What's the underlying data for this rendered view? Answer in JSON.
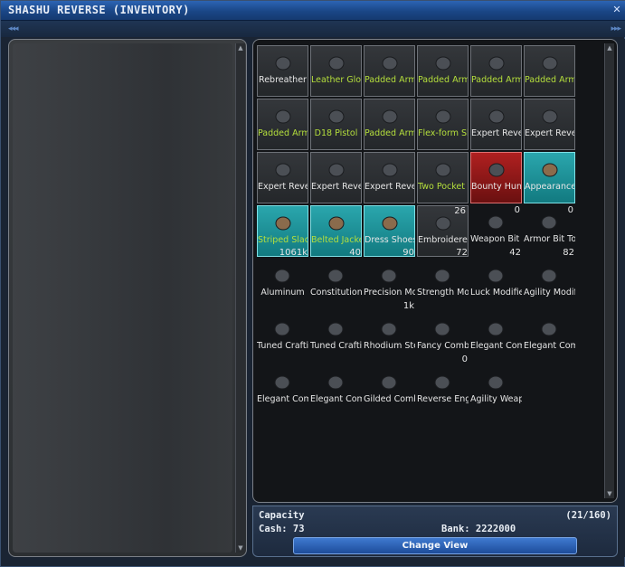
{
  "window": {
    "title": "SHASHU REVERSE (INVENTORY)"
  },
  "footer": {
    "capacity_label": "Capacity",
    "capacity_value": "(21/160)",
    "cash": "Cash: 73",
    "bank": "Bank: 2222000",
    "change_view": "Change View"
  },
  "items": [
    {
      "name": "Rebreather",
      "style": "frame",
      "text": "white",
      "qty": "",
      "qty_above": ""
    },
    {
      "name": "Leather Gloves",
      "style": "frame",
      "text": "green",
      "qty": "",
      "qty_above": ""
    },
    {
      "name": "Padded Armor Le...",
      "style": "frame",
      "text": "green",
      "qty": "",
      "qty_above": ""
    },
    {
      "name": "Padded Armor He...",
      "style": "frame",
      "text": "green",
      "qty": "",
      "qty_above": ""
    },
    {
      "name": "Padded Armor Bo...",
      "style": "frame",
      "text": "green",
      "qty": "",
      "qty_above": ""
    },
    {
      "name": "Padded Armor Le...",
      "style": "frame",
      "text": "green",
      "qty": "",
      "qty_above": ""
    },
    {
      "name": "Padded Armor Le...",
      "style": "frame",
      "text": "green",
      "qty": "",
      "qty_above": ""
    },
    {
      "name": "D18 Pistol",
      "style": "frame",
      "text": "green",
      "qty": "",
      "qty_above": ""
    },
    {
      "name": "Padded Armor Ch...",
      "style": "frame",
      "text": "green",
      "qty": "",
      "qty_above": ""
    },
    {
      "name": "Flex-form Shirt",
      "style": "frame",
      "text": "green",
      "qty": "",
      "qty_above": ""
    },
    {
      "name": "Expert Reverse ...",
      "style": "frame",
      "text": "white",
      "qty": "",
      "qty_above": ""
    },
    {
      "name": "Expert Reverse ...",
      "style": "frame",
      "text": "white",
      "qty": "",
      "qty_above": ""
    },
    {
      "name": "Expert Reverse ...",
      "style": "frame",
      "text": "white",
      "qty": "",
      "qty_above": ""
    },
    {
      "name": "Expert Reverse ...",
      "style": "frame",
      "text": "white",
      "qty": "",
      "qty_above": ""
    },
    {
      "name": "Expert Reverse ...",
      "style": "frame",
      "text": "white",
      "qty": "",
      "qty_above": ""
    },
    {
      "name": "Two Pocket B...",
      "style": "frame",
      "text": "green",
      "qty": "",
      "qty_above": ""
    },
    {
      "name": "Bounty Hunter L...",
      "style": "red",
      "text": "white",
      "qty": "",
      "qty_above": ""
    },
    {
      "name": "Appearance Tab Bel...",
      "style": "teal",
      "text": "white",
      "qty": "",
      "qty_above": ""
    },
    {
      "name": "Striped Slacks",
      "style": "teal",
      "text": "green",
      "qty": "",
      "qty_above": ""
    },
    {
      "name": "Belted Jacket",
      "style": "teal",
      "text": "green",
      "qty": "",
      "qty_above": ""
    },
    {
      "name": "Dress Shoes",
      "style": "teal",
      "text": "white",
      "qty": "",
      "qty_above": ""
    },
    {
      "name": "Embroidered Sash",
      "style": "frame",
      "text": "white",
      "qty": "26",
      "qty_above": ""
    },
    {
      "name": "Weapon Bit Tool",
      "style": "plain",
      "text": "white",
      "qty": "0",
      "qty_above": ""
    },
    {
      "name": "Armor Bit Tool",
      "style": "plain",
      "text": "white",
      "qty": "0",
      "qty_above": ""
    },
    {
      "name": "Aluminum",
      "style": "plain",
      "text": "white",
      "qty": "",
      "qty_above": "1061k"
    },
    {
      "name": "Constitution Modifie...",
      "style": "plain",
      "text": "white",
      "qty": "",
      "qty_above": "40"
    },
    {
      "name": "Precision Modifier Bit",
      "style": "plain",
      "text": "white",
      "qty": "",
      "qty_above": "90"
    },
    {
      "name": "Strength Modifier Bit",
      "style": "plain",
      "text": "white",
      "qty": "",
      "qty_above": "72"
    },
    {
      "name": "Luck Modifier Bit",
      "style": "plain",
      "text": "white",
      "qty": "",
      "qty_above": "42"
    },
    {
      "name": "Agility Modifier Bit",
      "style": "plain",
      "text": "white",
      "qty": "",
      "qty_above": "82"
    },
    {
      "name": "Tuned Crafting ...",
      "style": "plain",
      "text": "white",
      "qty": "",
      "qty_above": ""
    },
    {
      "name": "Tuned Crafting ...",
      "style": "plain",
      "text": "white",
      "qty": "",
      "qty_above": ""
    },
    {
      "name": "Rhodium Steel (Ca...",
      "style": "plain",
      "text": "white",
      "qty": "",
      "qty_above": "1k"
    },
    {
      "name": "Fancy Combata...",
      "style": "plain",
      "text": "white",
      "qty": "",
      "qty_above": ""
    },
    {
      "name": "Elegant Combata...",
      "style": "plain",
      "text": "white",
      "qty": "",
      "qty_above": ""
    },
    {
      "name": "Elegant Combata...",
      "style": "plain",
      "text": "white",
      "qty": "",
      "qty_above": ""
    },
    {
      "name": "Elegant Combata...",
      "style": "plain",
      "text": "white",
      "qty": "",
      "qty_above": ""
    },
    {
      "name": "Elegant Combata...",
      "style": "plain",
      "text": "white",
      "qty": "",
      "qty_above": ""
    },
    {
      "name": "Gilded Combata...",
      "style": "plain",
      "text": "white",
      "qty": "",
      "qty_above": ""
    },
    {
      "name": "Reverse Engineeri...",
      "style": "plain",
      "text": "white",
      "qty": "",
      "qty_above": "0"
    },
    {
      "name": "Agility Weapon ...",
      "style": "plain",
      "text": "white",
      "qty": "",
      "qty_above": ""
    }
  ]
}
